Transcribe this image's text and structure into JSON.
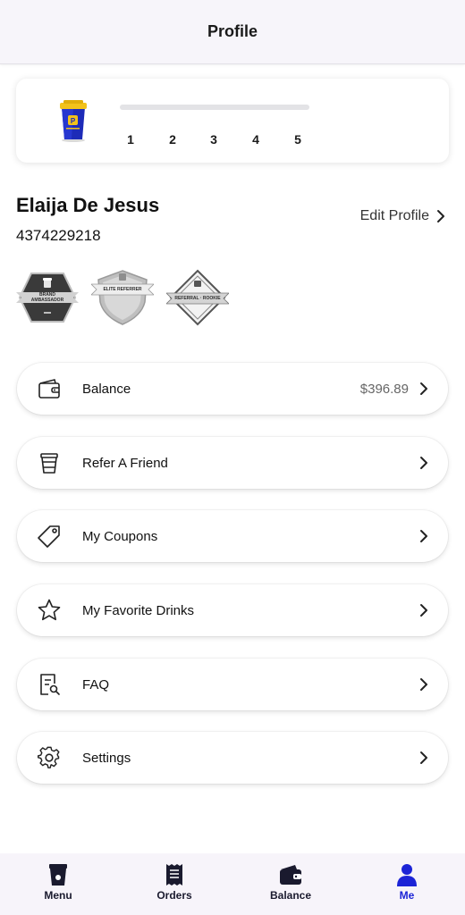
{
  "header": {
    "title": "Profile"
  },
  "level": {
    "steps": [
      "1",
      "2",
      "3",
      "4",
      "5"
    ],
    "progress": 0
  },
  "user": {
    "name": "Elaija De Jesus",
    "phone": "4374229218",
    "edit_label": "Edit Profile"
  },
  "badges": [
    {
      "line1": "Brand",
      "line2": "Ambassador"
    },
    {
      "line1": "Elite Referrer"
    },
    {
      "line1": "Referral · Rookie"
    }
  ],
  "menu": {
    "balance": {
      "label": "Balance",
      "value": "$396.89"
    },
    "refer": {
      "label": "Refer A Friend"
    },
    "coupons": {
      "label": "My Coupons"
    },
    "favorites": {
      "label": "My Favorite Drinks"
    },
    "faq": {
      "label": "FAQ"
    },
    "settings": {
      "label": "Settings"
    }
  },
  "nav": {
    "menu": "Menu",
    "orders": "Orders",
    "balance": "Balance",
    "me": "Me"
  },
  "colors": {
    "accent": "#1c24d6",
    "nav_icon": "#1a1a2e",
    "header_bg": "#f7f5fa"
  }
}
